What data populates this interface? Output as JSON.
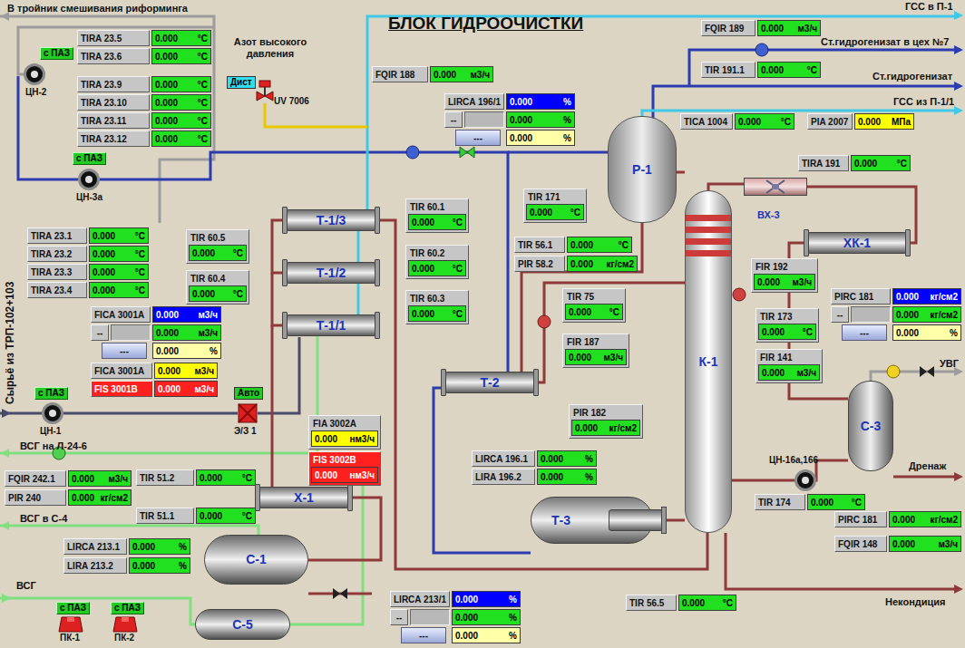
{
  "title": "БЛОК ГИДРООЧИСТКИ",
  "streams": [
    {
      "text": "В тройник смешивания риформинга",
      "kind": "label"
    },
    {
      "text": "Азот высокого давления",
      "kind": "wrap"
    },
    {
      "text": "ГСС в П-1",
      "kind": "label"
    },
    {
      "text": "Ст.гидрогенизат в цех №7",
      "kind": "label"
    },
    {
      "text": "Ст.гидрогенизат",
      "kind": "label"
    },
    {
      "text": "ГСС из П-1/1",
      "kind": "label"
    },
    {
      "text": "УВГ",
      "kind": "label"
    },
    {
      "text": "Дренаж",
      "kind": "label"
    },
    {
      "text": "Некондиция",
      "kind": "label"
    },
    {
      "text": "ВСГ на Л-24-6",
      "kind": "label"
    },
    {
      "text": "ВСГ в С-4",
      "kind": "label"
    },
    {
      "text": "ВСГ",
      "kind": "label"
    },
    {
      "text": "Сырьё из ТРП-102+103",
      "kind": "vertical"
    }
  ],
  "equipment": [
    {
      "label": "Р-1",
      "kind": "reactor"
    },
    {
      "label": "К-1",
      "kind": "column"
    },
    {
      "label": "Т-1/3",
      "kind": "exchanger"
    },
    {
      "label": "Т-1/2",
      "kind": "exchanger"
    },
    {
      "label": "Т-1/1",
      "kind": "exchanger"
    },
    {
      "label": "Т-2",
      "kind": "exchanger"
    },
    {
      "label": "Т-3",
      "kind": "kettle"
    },
    {
      "label": "Х-1",
      "kind": "exchanger"
    },
    {
      "label": "С-1",
      "kind": "vessel-h"
    },
    {
      "label": "С-5",
      "kind": "vessel-h"
    },
    {
      "label": "С-3",
      "kind": "vessel-v"
    },
    {
      "label": "ХК-1",
      "kind": "exchanger"
    },
    {
      "label": "ВХ-3",
      "kind": "fan"
    }
  ],
  "pumps": [
    {
      "label": "ЦН-2",
      "badge": "с ПАЗ",
      "kind": "pump"
    },
    {
      "label": "ЦН-3а",
      "badge": "с ПАЗ",
      "kind": "pump"
    },
    {
      "label": "ЦН-1",
      "badge": "с ПАЗ",
      "kind": "pump"
    },
    {
      "label": "ЦН-16а,166",
      "kind": "pump"
    },
    {
      "label": "ПК-1",
      "badge": "с ПАЗ",
      "kind": "compressor"
    },
    {
      "label": "ПК-2",
      "badge": "с ПАЗ",
      "kind": "compressor"
    }
  ],
  "valves": [
    {
      "label": "UV 7006",
      "badge": "Дист",
      "color": "#33ddee",
      "kind": "actuated"
    },
    {
      "label": "Э/З 1",
      "badge": "Авто",
      "color": "#22cc22",
      "kind": "shutoff"
    }
  ],
  "tags": [
    {
      "label": "TIRA 23.5",
      "value": "0.000",
      "unit": "°C",
      "kind": "inline",
      "color": "#20e020"
    },
    {
      "label": "TIRA 23.6",
      "value": "0.000",
      "unit": "°C",
      "kind": "inline",
      "color": "#20e020"
    },
    {
      "label": "TIRA 23.9",
      "value": "0.000",
      "unit": "°C",
      "kind": "inline",
      "color": "#20e020"
    },
    {
      "label": "TIRA 23.10",
      "value": "0.000",
      "unit": "°C",
      "kind": "inline",
      "color": "#20e020"
    },
    {
      "label": "TIRA 23.11",
      "value": "0.000",
      "unit": "°C",
      "kind": "inline",
      "color": "#20e020"
    },
    {
      "label": "TIRA 23.12",
      "value": "0.000",
      "unit": "°C",
      "kind": "inline",
      "color": "#20e020"
    },
    {
      "label": "TIRA 23.1",
      "value": "0.000",
      "unit": "°C",
      "kind": "inline",
      "color": "#20e020"
    },
    {
      "label": "TIRA 23.2",
      "value": "0.000",
      "unit": "°C",
      "kind": "inline",
      "color": "#20e020"
    },
    {
      "label": "TIRA 23.3",
      "value": "0.000",
      "unit": "°C",
      "kind": "inline",
      "color": "#20e020"
    },
    {
      "label": "TIRA 23.4",
      "value": "0.000",
      "unit": "°C",
      "kind": "inline",
      "color": "#20e020"
    },
    {
      "label": "FQIR 188",
      "value": "0.000",
      "unit": "м3/ч",
      "kind": "inline",
      "color": "#20e020"
    },
    {
      "label": "FQIR 189",
      "value": "0.000",
      "unit": "м3/ч",
      "kind": "inline",
      "color": "#20e020"
    },
    {
      "label": "TIR 191.1",
      "value": "0.000",
      "unit": "°C",
      "kind": "inline",
      "color": "#20e020"
    },
    {
      "label": "TICA 1004",
      "value": "0.000",
      "unit": "°C",
      "kind": "inline",
      "color": "#20e020"
    },
    {
      "label": "PIA 2007",
      "value": "0.000",
      "unit": "МПа",
      "kind": "inline",
      "color": "#ffff00"
    },
    {
      "label": "TIRA 191",
      "value": "0.000",
      "unit": "°C",
      "kind": "inline",
      "color": "#20e020"
    },
    {
      "label": "TIR 56.1",
      "value": "0.000",
      "unit": "°C",
      "kind": "inline",
      "color": "#20e020"
    },
    {
      "label": "PIR 58.2",
      "value": "0.000",
      "unit": "кг/см2",
      "kind": "inline",
      "color": "#20e020"
    },
    {
      "label": "FICA 3001A",
      "value": "0.000",
      "unit": "м3/ч",
      "kind": "inline",
      "color": "#ffff00"
    },
    {
      "label": "FIS 3001B",
      "value": "0.000",
      "unit": "м3/ч",
      "kind": "inline",
      "color": "#ff2020"
    },
    {
      "label": "LIRCA 196.1",
      "value": "0.000",
      "unit": "%",
      "kind": "inline",
      "color": "#20e020"
    },
    {
      "label": "LIRA 196.2",
      "value": "0.000",
      "unit": "%",
      "kind": "inline",
      "color": "#20e020"
    },
    {
      "label": "TIR 174",
      "value": "0.000",
      "unit": "°C",
      "kind": "inline",
      "color": "#20e020"
    },
    {
      "label": "PIRC 181",
      "value": "0.000",
      "unit": "кг/см2",
      "kind": "inline",
      "color": "#20e020"
    },
    {
      "label": "FQIR 148",
      "value": "0.000",
      "unit": "м3/ч",
      "kind": "inline",
      "color": "#20e020"
    },
    {
      "label": "TIR 56.5",
      "value": "0.000",
      "unit": "°C",
      "kind": "inline",
      "color": "#20e020"
    },
    {
      "label": "FQIR 242.1",
      "value": "0.000",
      "unit": "м3/ч",
      "kind": "inline",
      "color": "#20e020"
    },
    {
      "label": "PIR 240",
      "value": "0.000",
      "unit": "кг/см2",
      "kind": "inline",
      "color": "#20e020"
    },
    {
      "label": "TIR 51.2",
      "value": "0.000",
      "unit": "°C",
      "kind": "inline",
      "color": "#20e020"
    },
    {
      "label": "TIR 51.1",
      "value": "0.000",
      "unit": "°C",
      "kind": "inline",
      "color": "#20e020"
    },
    {
      "label": "LIRCA 213.1",
      "value": "0.000",
      "unit": "%",
      "kind": "inline",
      "color": "#20e020"
    },
    {
      "label": "LIRA 213.2",
      "value": "0.000",
      "unit": "%",
      "kind": "inline",
      "color": "#20e020"
    },
    {
      "label": "TIR 171",
      "value": "0.000",
      "unit": "°C",
      "kind": "stacked",
      "color": "#20e020"
    },
    {
      "label": "TIR 60.1",
      "value": "0.000",
      "unit": "°C",
      "kind": "stacked",
      "color": "#20e020"
    },
    {
      "label": "TIR 60.2",
      "value": "0.000",
      "unit": "°C",
      "kind": "stacked",
      "color": "#20e020"
    },
    {
      "label": "TIR 60.3",
      "value": "0.000",
      "unit": "°C",
      "kind": "stacked",
      "color": "#20e020"
    },
    {
      "label": "TIR 60.5",
      "value": "0.000",
      "unit": "°C",
      "kind": "stacked",
      "color": "#20e020"
    },
    {
      "label": "TIR 60.4",
      "value": "0.000",
      "unit": "°C",
      "kind": "stacked",
      "color": "#20e020"
    },
    {
      "label": "TIR 75",
      "value": "0.000",
      "unit": "°C",
      "kind": "stacked",
      "color": "#20e020"
    },
    {
      "label": "FIR 187",
      "value": "0.000",
      "unit": "м3/ч",
      "kind": "stacked",
      "color": "#20e020"
    },
    {
      "label": "FIR 192",
      "value": "0.000",
      "unit": "м3/ч",
      "kind": "stacked",
      "color": "#20e020"
    },
    {
      "label": "TIR 173",
      "value": "0.000",
      "unit": "°C",
      "kind": "stacked",
      "color": "#20e020"
    },
    {
      "label": "FIR 141",
      "value": "0.000",
      "unit": "м3/ч",
      "kind": "stacked",
      "color": "#20e020"
    },
    {
      "label": "FIA 3002A",
      "value": "0.000",
      "unit": "нм3/ч",
      "kind": "stacked",
      "color": "#ffff00"
    },
    {
      "label": "FIS 3002B",
      "value": "0.000",
      "unit": "нм3/ч",
      "kind": "stacked",
      "color": "#ff2020"
    },
    {
      "label": "PIR 182",
      "value": "0.000",
      "unit": "кг/см2",
      "kind": "stacked",
      "color": "#20e020"
    }
  ],
  "controllers": [
    {
      "label": "LIRCA 196/1",
      "buttons": [
        "--",
        "---"
      ],
      "rows": [
        {
          "value": "0.000",
          "unit": "%",
          "color": "#0000ff"
        },
        {
          "value": "0.000",
          "unit": "%",
          "color": "#20e020"
        },
        {
          "value": "0.000",
          "unit": "%",
          "color": "#ffffa8"
        }
      ]
    },
    {
      "label": "FICA 3001A",
      "buttons": [
        "--",
        "---"
      ],
      "rows": [
        {
          "value": "0.000",
          "unit": "м3/ч",
          "color": "#0000ff"
        },
        {
          "value": "0.000",
          "unit": "м3/ч",
          "color": "#20e020"
        },
        {
          "value": "0.000",
          "unit": "%",
          "color": "#ffffa8"
        }
      ]
    },
    {
      "label": "PIRC 181",
      "buttons": [
        "--",
        "---"
      ],
      "rows": [
        {
          "value": "0.000",
          "unit": "кг/см2",
          "color": "#0000ff"
        },
        {
          "value": "0.000",
          "unit": "кг/см2",
          "color": "#20e020"
        },
        {
          "value": "0.000",
          "unit": "%",
          "color": "#ffffa8"
        }
      ]
    },
    {
      "label": "LIRCA 213/1",
      "buttons": [
        "--",
        "---"
      ],
      "rows": [
        {
          "value": "0.000",
          "unit": "%",
          "color": "#0000ff"
        },
        {
          "value": "0.000",
          "unit": "%",
          "color": "#20e020"
        },
        {
          "value": "0.000",
          "unit": "%",
          "color": "#ffffa8"
        }
      ]
    }
  ]
}
